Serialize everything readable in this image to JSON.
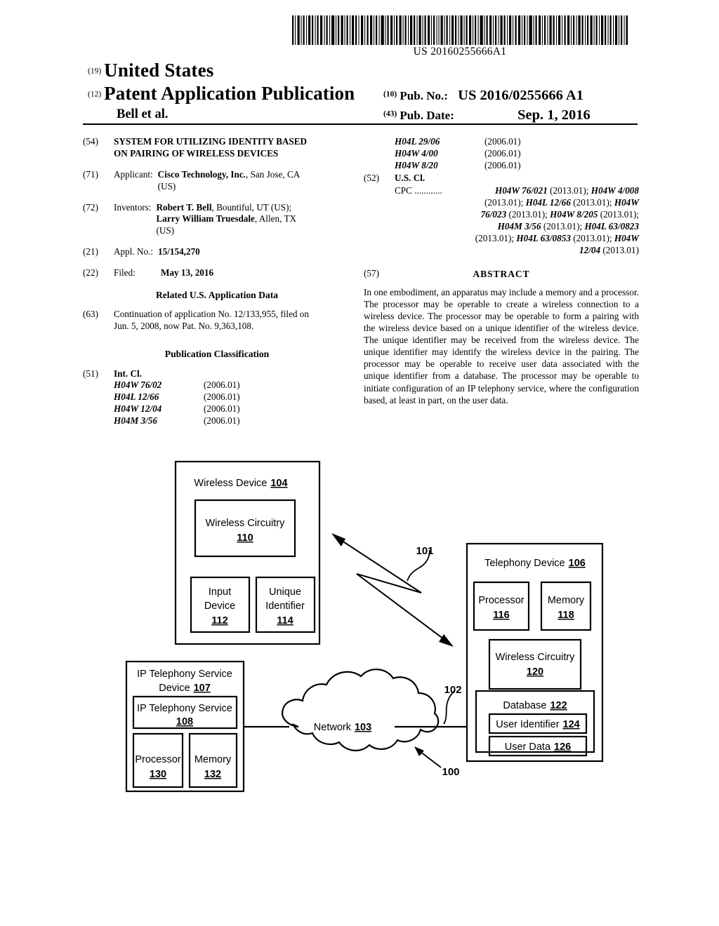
{
  "header": {
    "barcode_number": "US 20160255666A1",
    "country_code": "(19)",
    "country": "United States",
    "pubtype_code": "(12)",
    "pubtype": "Patent Application Publication",
    "authors": "Bell et al.",
    "pubno_code": "(10)",
    "pubno_label": "Pub. No.:",
    "pubno_value": "US 2016/0255666 A1",
    "pubdate_code": "(43)",
    "pubdate_label": "Pub. Date:",
    "pubdate_value": "Sep. 1, 2016"
  },
  "left_column": {
    "title_code": "(54)",
    "title_line1": "SYSTEM FOR UTILIZING IDENTITY BASED",
    "title_line2": "ON PAIRING OF WIRELESS DEVICES",
    "applicant_code": "(71)",
    "applicant_label": "Applicant:",
    "applicant_name": "Cisco Technology, Inc.",
    "applicant_rest": ", San Jose, CA",
    "applicant_line2": "(US)",
    "inventors_code": "(72)",
    "inventors_label": "Inventors:",
    "inventor1_name": "Robert T. Bell",
    "inventor1_rest": ", Bountiful, UT (US);",
    "inventor2_name": "Larry William Truesdale",
    "inventor2_rest": ", Allen, TX",
    "inventors_line3": "(US)",
    "applno_code": "(21)",
    "applno_label": "Appl. No.:",
    "applno_value": "15/154,270",
    "filed_code": "(22)",
    "filed_label": "Filed:",
    "filed_value": "May 13, 2016",
    "related_heading": "Related U.S. Application Data",
    "related_code": "(63)",
    "related_line1": "Continuation of application No. 12/133,955, filed on",
    "related_line2": "Jun. 5, 2008, now Pat. No. 9,363,108.",
    "pubclass_heading": "Publication Classification",
    "intcl_code": "(51)",
    "intcl_label": "Int. Cl.",
    "intcl_entries": [
      {
        "code": "H04W 76/02",
        "version": "(2006.01)"
      },
      {
        "code": "H04L 12/66",
        "version": "(2006.01)"
      },
      {
        "code": "H04W 12/04",
        "version": "(2006.01)"
      },
      {
        "code": "H04M 3/56",
        "version": "(2006.01)"
      }
    ]
  },
  "right_column": {
    "intcl_entries_cont": [
      {
        "code": "H04L 29/06",
        "version": "(2006.01)"
      },
      {
        "code": "H04W 4/00",
        "version": "(2006.01)"
      },
      {
        "code": "H04W 8/20",
        "version": "(2006.01)"
      }
    ],
    "uscl_code": "(52)",
    "uscl_label": "U.S. Cl.",
    "cpc_lead": "CPC ............",
    "cpc_line1_a": "H04W 76/021",
    "cpc_line1_b": " (2013.01); ",
    "cpc_line1_c": "H04W 4/008",
    "cpc_line2_a": "(2013.01); ",
    "cpc_line2_b": "H04L 12/66",
    "cpc_line2_c": " (2013.01); ",
    "cpc_line2_d": "H04W",
    "cpc_line3_a": "76/023",
    "cpc_line3_b": " (2013.01); ",
    "cpc_line3_c": "H04W 8/205",
    "cpc_line3_d": " (2013.01);",
    "cpc_line4_a": "H04M 3/56",
    "cpc_line4_b": " (2013.01); ",
    "cpc_line4_c": "H04L 63/0823",
    "cpc_line5_a": "(2013.01); ",
    "cpc_line5_b": "H04L 63/0853",
    "cpc_line5_c": " (2013.01); ",
    "cpc_line5_d": "H04W",
    "cpc_line6_a": "12/04",
    "cpc_line6_b": " (2013.01)",
    "abstract_code": "(57)",
    "abstract_title": "ABSTRACT",
    "abstract_text": "In one embodiment, an apparatus may include a memory and a processor. The processor may be operable to create a wireless connection to a wireless device. The processor may be operable to form a pairing with the wireless device based on a unique identifier of the wireless device. The unique identifier may be received from the wireless device. The unique identifier may identify the wireless device in the pairing. The processor may be operable to receive user data associated with the unique identifier from a database. The processor may be operable to initiate configuration of an IP telephony service, where the configuration based, at least in part, on the user data."
  },
  "figure": {
    "system_ref": "100",
    "wireless_link_ref": "101",
    "network_link_ref": "102",
    "wireless_device": {
      "title": "Wireless Device",
      "ref": "104",
      "wireless_circuitry_title": "Wireless Circuitry",
      "wireless_circuitry_ref": "110",
      "input_device_line1": "Input",
      "input_device_line2": "Device",
      "input_device_ref": "112",
      "unique_identifier_line1": "Unique",
      "unique_identifier_line2": "Identifier",
      "unique_identifier_ref": "114"
    },
    "telephony_device": {
      "title": "Telephony Device",
      "ref": "106",
      "processor_title": "Processor",
      "processor_ref": "116",
      "memory_title": "Memory",
      "memory_ref": "118",
      "wireless_circuitry_title": "Wireless Circuitry",
      "wireless_circuitry_ref": "120",
      "database_title": "Database",
      "database_ref": "122",
      "user_identifier_title": "User Identifier",
      "user_identifier_ref": "124",
      "user_data_title": "User Data",
      "user_data_ref": "126"
    },
    "ip_telephony_service_device": {
      "title_line1": "IP Telephony Service",
      "title_line2": "Device",
      "ref": "107",
      "service_title": "IP Telephony Service",
      "service_ref": "108",
      "processor_title": "Processor",
      "processor_ref": "130",
      "memory_title": "Memory",
      "memory_ref": "132"
    },
    "network": {
      "title": "Network",
      "ref": "103"
    }
  }
}
